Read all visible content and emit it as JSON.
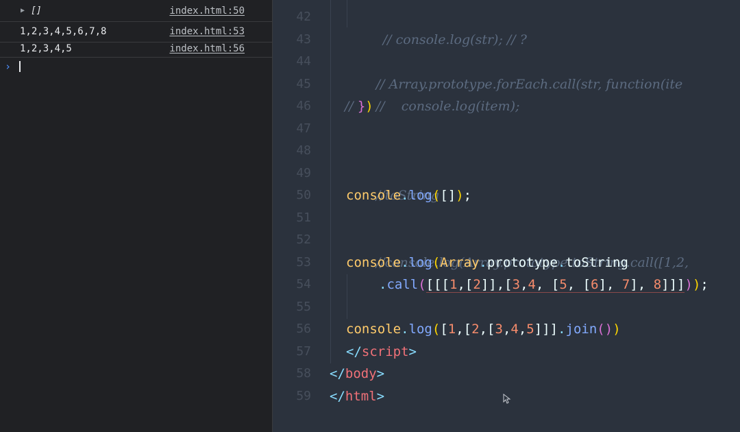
{
  "console": {
    "rows": [
      {
        "value": "[]",
        "source": "index.html:50"
      },
      {
        "value": "1,2,3,4,5,6,7,8",
        "source": "index.html:53"
      },
      {
        "value": "1,2,3,4,5",
        "source": "index.html:56"
      }
    ],
    "prompt_symbol": "›"
  },
  "editor": {
    "line_numbers": [
      "42",
      "43",
      "44",
      "45",
      "46",
      "47",
      "48",
      "49",
      "50",
      "51",
      "52",
      "53",
      "54",
      "55",
      "56",
      "57",
      "58",
      "59"
    ],
    "lines": {
      "l42": {
        "comment": "// console.log(str); // ?"
      },
      "l44": {
        "comment": "// Array.prototype.forEach.call(str, function(ite"
      },
      "l45": {
        "comment": "//    console.log(item);"
      },
      "l46": {
        "comment_open": "// ",
        "brace": "}",
        "paren": ")"
      },
      "l49": {
        "comment": "//toString"
      },
      "l50": {
        "obj": "console",
        "dot": ".",
        "fn": "log",
        "open": "(",
        "arr": "[]",
        "close": ")",
        "semi": ";"
      },
      "l52": {
        "comment": "//console.log(Array.prototype.toString.call([1,2,"
      },
      "l53": {
        "obj": "console",
        "dot": ".",
        "fn": "log",
        "open": "(",
        "arr_obj": "Array",
        "dot2": ".",
        "proto": "prototype",
        "dot3": ".",
        "method": "toString"
      },
      "l54": {
        "dot": ".",
        "fn": "call",
        "open": "(",
        "b1": "[[[",
        "n1": "1",
        "c1": ",",
        "b2": "[",
        "n2": "2",
        "b3": "]]",
        "c2": ",",
        "b4": "[",
        "n3": "3",
        "c3": ",",
        "n4": "4",
        "c4": ", ",
        "b5": "[",
        "n5": "5",
        "c5": ", ",
        "b6": "[",
        "n6": "6",
        "b7": "]",
        "c6": ", ",
        "n7": "7",
        "b8": "]",
        "c7": ", ",
        "n8": "8",
        "b9": "]]]",
        "close": ")",
        "close2": ")",
        "semi": ";"
      },
      "l56": {
        "obj": "console",
        "dot": ".",
        "fn": "log",
        "open": "(",
        "b1": "[",
        "n1": "1",
        "c1": ",",
        "b2": "[",
        "n2": "2",
        "c2": ",",
        "b3": "[",
        "n3": "3",
        "c3": ",",
        "n4": "4",
        "c4": ",",
        "n5": "5",
        "b4": "]]]",
        "dot2": ".",
        "method": "join",
        "call": "()",
        "close": ")"
      },
      "l57": {
        "open": "</",
        "name": "script",
        "close": ">"
      },
      "l58": {
        "open": "</",
        "name": "body",
        "close": ">"
      },
      "l59": {
        "open": "</",
        "name": "html",
        "close": ">"
      }
    },
    "colors": {
      "background": "#2b323d",
      "comment": "#5c6b80",
      "object": "#ffcb6b",
      "function": "#82aaff",
      "number": "#f78c6c",
      "tag": "#f07178"
    }
  }
}
